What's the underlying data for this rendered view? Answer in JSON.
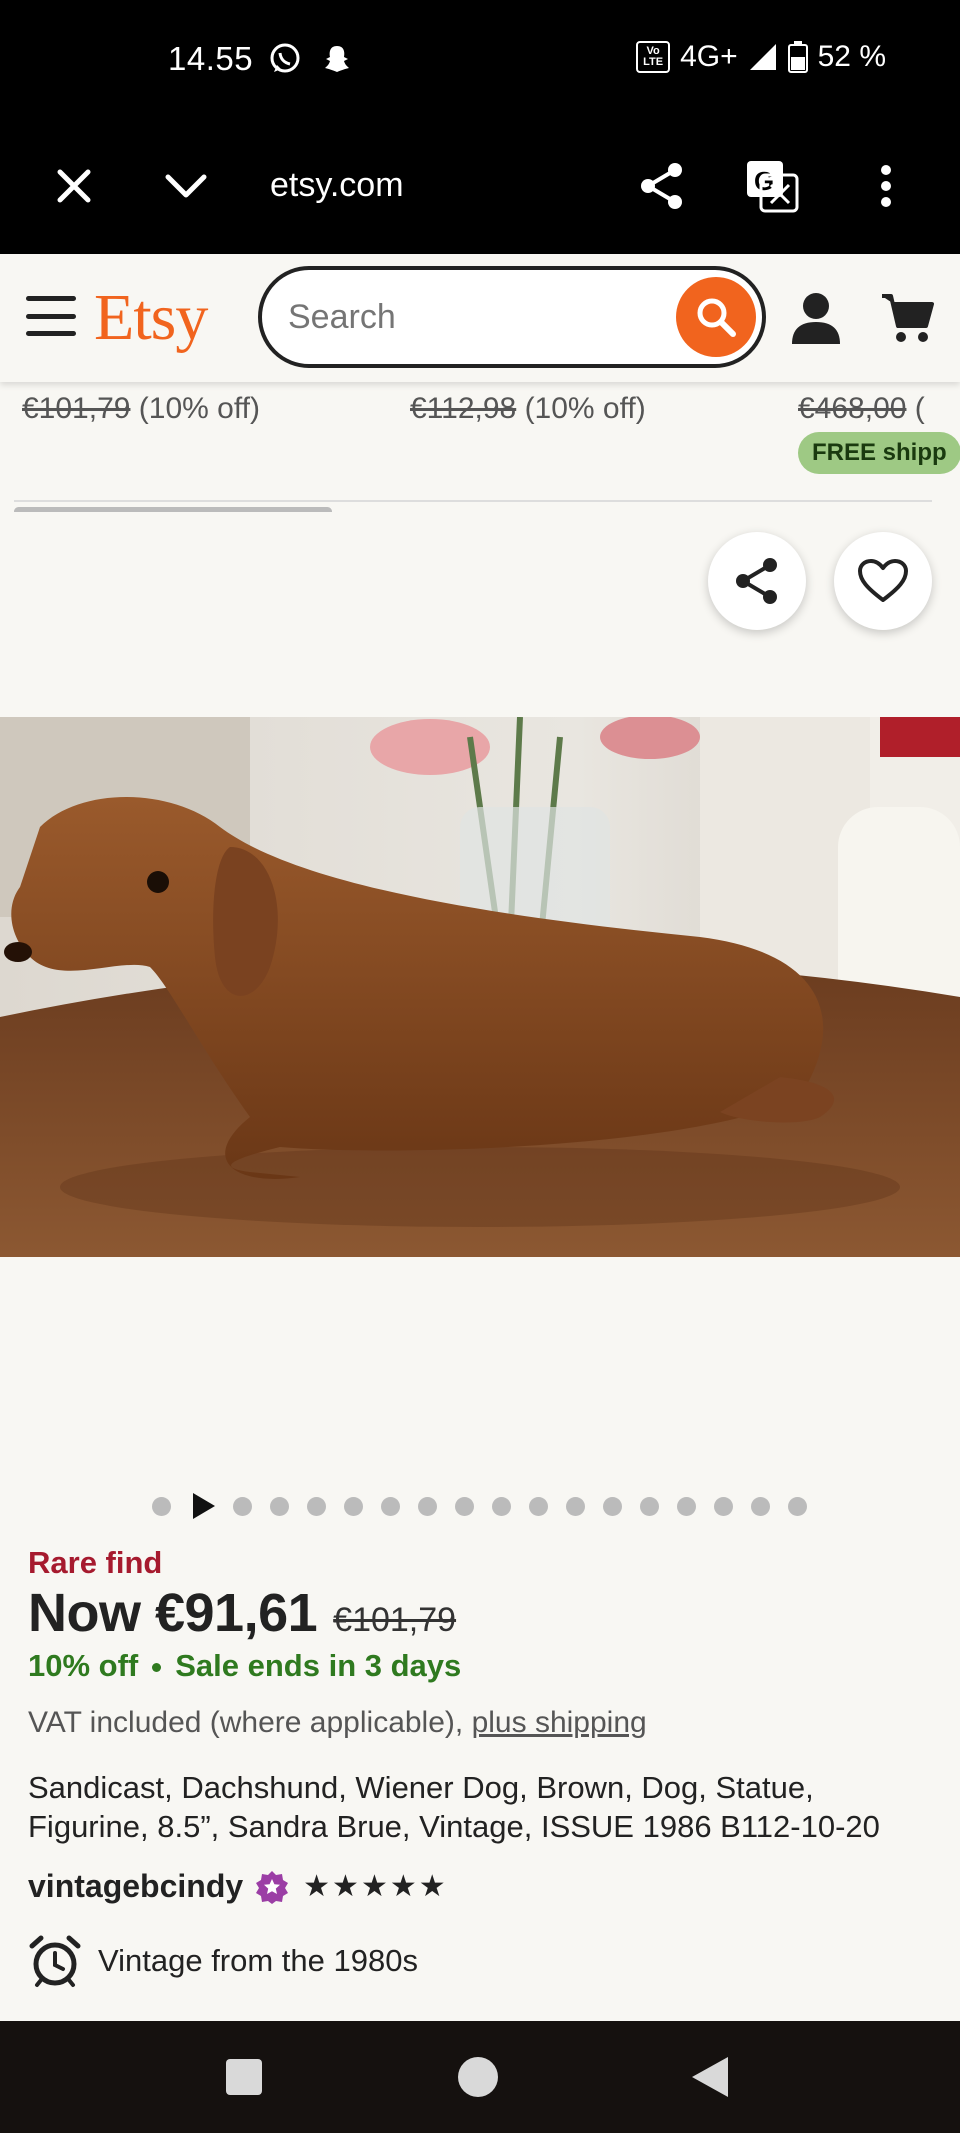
{
  "status_bar": {
    "time": "14.55",
    "network": "4G+",
    "battery": "52 %",
    "volte_top": "Vo",
    "volte_bottom": "LTE"
  },
  "browser": {
    "url": "etsy.com"
  },
  "header": {
    "logo": "Etsy",
    "search_placeholder": "Search"
  },
  "related": [
    {
      "old_price": "€101,79",
      "discount": "(10% off)"
    },
    {
      "old_price": "€112,98",
      "discount": "(10% off)"
    },
    {
      "old_price": "€468,00",
      "discount": "(",
      "badge": "FREE shipp"
    }
  ],
  "carousel": {
    "image_count": 18,
    "current_index": 1
  },
  "product": {
    "rare_label": "Rare find",
    "price_now": "Now €91,61",
    "price_old": "€101,79",
    "discount": "10% off",
    "sale_ends": "Sale ends in 3 days",
    "vat_text": "VAT included (where applicable),",
    "shipping_link": "plus shipping",
    "title": "Sandicast, Dachshund, Wiener Dog, Brown, Dog, Statue, Figurine, 8.5”, Sandra Brue, Vintage, ISSUE 1986 B112-10-20",
    "shop_name": "vintagebcindy",
    "rating_stars": "★★★★★",
    "vintage": "Vintage from the 1980s"
  },
  "colors": {
    "brand": "#f1641e",
    "rare": "#a61a2e",
    "sale": "#2f7a1f",
    "star_seller": "#9b3ea5"
  }
}
